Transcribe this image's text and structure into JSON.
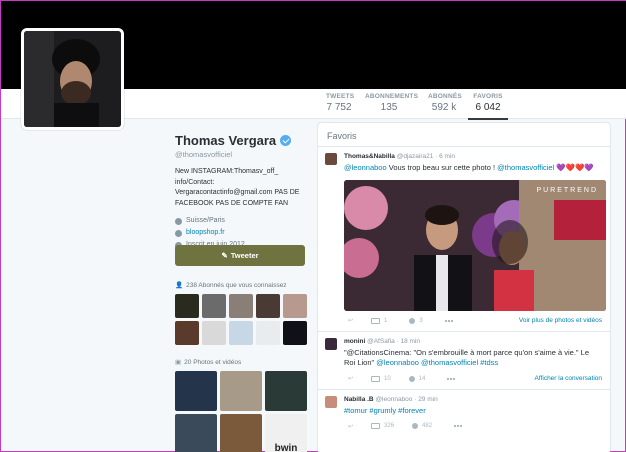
{
  "profile": {
    "name": "Thomas Vergara",
    "handle": "@thomasvofficiel",
    "bio": "New INSTAGRAM:Thomasv_off_ info/Contact: Vergaracontactinfo@gmail.com PAS DE FACEBOOK PAS DE COMPTE FAN",
    "location": "Suisse/Paris",
    "website": "bloopshop.fr",
    "joined": "Inscrit en juin 2012"
  },
  "stats": [
    {
      "label": "TWEETS",
      "value": "7 752"
    },
    {
      "label": "ABONNEMENTS",
      "value": "135"
    },
    {
      "label": "ABONNÉS",
      "value": "592 k"
    },
    {
      "label": "FAVORIS",
      "value": "6 042"
    }
  ],
  "tweet_button": "Tweeter",
  "followers_you_know": "238 Abonnés que vous connaissez",
  "media_title": "20 Photos et vidéos",
  "favorites": {
    "title": "Favoris",
    "tweets": [
      {
        "author": "Thomas&Nabilla",
        "handle": "@djazaira21",
        "time": "· 6 min",
        "mention1": "@leonnaboo",
        "text": " Vous trop beau sur cette photo ! ",
        "mention2": "@thomasvofficiel",
        "emoji": " 💜❤️❤️💜",
        "retweets": "1",
        "likes": "3",
        "more": "Voir plus de photos et vidéos",
        "photo_brand": "PURETREND"
      },
      {
        "author": "monini",
        "handle": "@AfSafia",
        "time": "· 18 min",
        "text1": "\"@CitationsCinema: \"On s'embrouille à mort parce qu'on s'aime à vie.\" Le Roi Lion\"",
        "mention1": "@leonnaboo",
        "mention2": "@thomasvofficiel",
        "tag": "#tdss",
        "retweets": "10",
        "likes": "14",
        "more": "Afficher la conversation"
      },
      {
        "author": "Nabilla .B",
        "handle": "@leonnaboo",
        "time": "· 29 min",
        "text": "#tomur #grumly #forever",
        "retweets": "326",
        "likes": "482"
      }
    ]
  },
  "colors": {
    "accent": "#6e733f",
    "link": "#0084b4",
    "verified": "#55acee"
  }
}
